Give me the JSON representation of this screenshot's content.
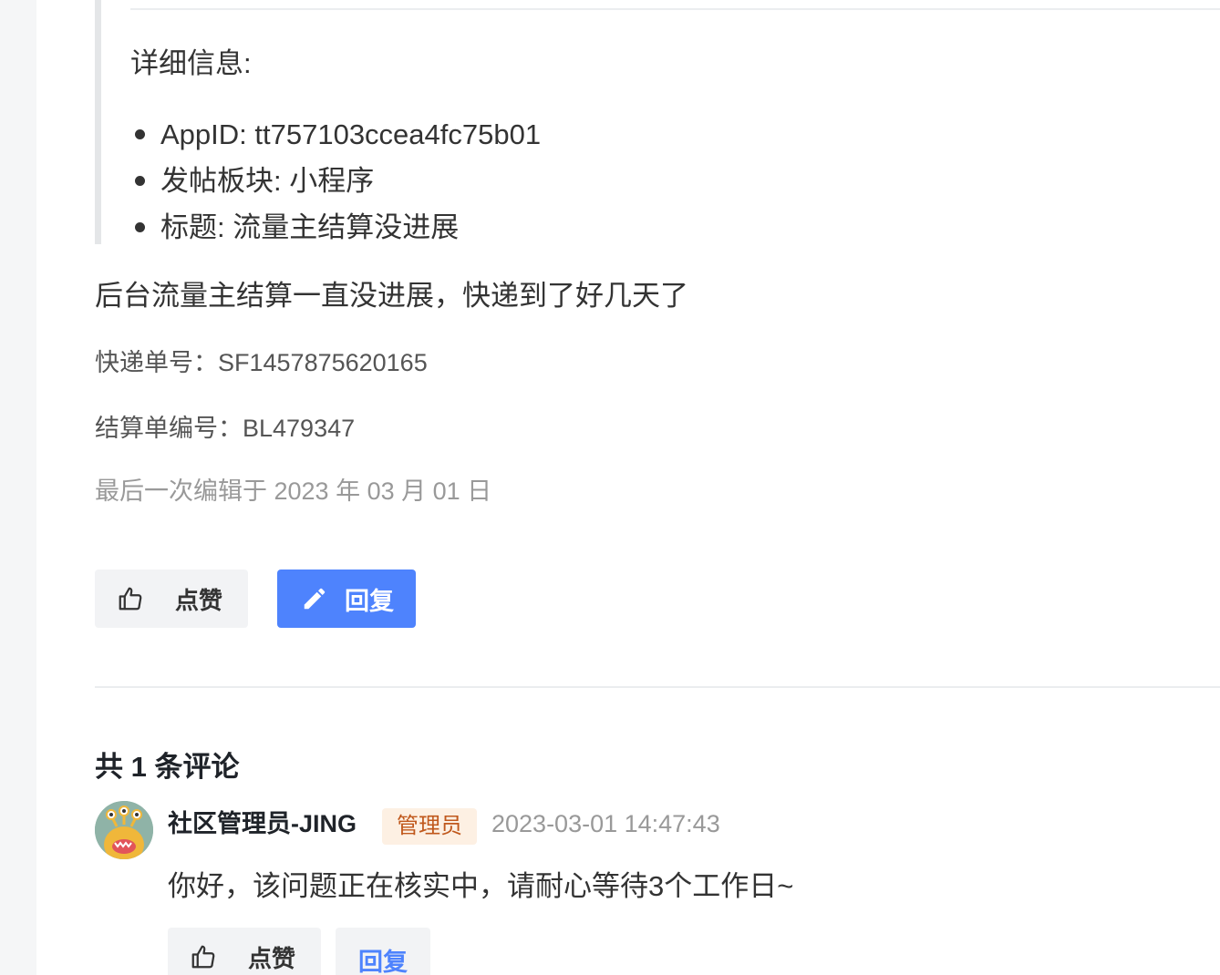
{
  "post": {
    "detail_heading": "详细信息:",
    "details": [
      {
        "text": "AppID: tt757103ccea4fc75b01"
      },
      {
        "text": "发帖板块: 小程序"
      },
      {
        "text": "标题: 流量主结算没进展"
      }
    ],
    "body_text": "后台流量主结算一直没进展，快递到了好几天了",
    "express_line": "快递单号：SF1457875620165",
    "settlement_line": "结算单编号：BL479347",
    "edited_text": "最后一次编辑于 2023 年 03 月 01 日",
    "like_label": "点赞",
    "reply_label": "回复",
    "like_icon": "thumbs-up-icon",
    "reply_icon": "pencil-icon"
  },
  "comments_section": {
    "count_text": "共 1 条评论",
    "comments": [
      {
        "author": "社区管理员-JING",
        "badge": "管理员",
        "time": "2023-03-01 14:47:43",
        "body": "你好，该问题正在核实中，请耐心等待3个工作日~",
        "like_label": "点赞",
        "reply_label": "回复",
        "avatar_icon": "monster-avatar-icon"
      }
    ]
  },
  "colors": {
    "primary": "#4e83fd",
    "badge_bg": "#fdf0e3",
    "badge_text": "#c0581c",
    "muted_text": "#999999",
    "button_bg": "#f2f3f5"
  }
}
